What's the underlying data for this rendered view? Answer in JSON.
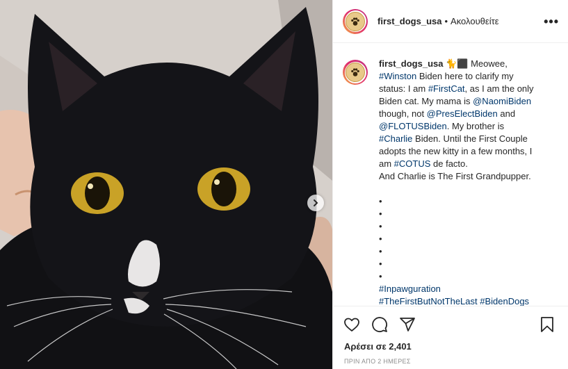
{
  "post": {
    "username": "first_dogs_usa",
    "dot": "•",
    "follow_status": "Ακολουθείτε",
    "more_label": "•••"
  },
  "caption": {
    "username": "first_dogs_usa",
    "emoji": "🐈⬛",
    "lines": [
      {
        "parts": [
          {
            "t": " Meowee,"
          }
        ]
      },
      {
        "parts": [
          {
            "t": "#Winston",
            "tag": true
          },
          {
            "t": " Biden here to clarify my"
          }
        ]
      },
      {
        "parts": [
          {
            "t": "status: I am "
          },
          {
            "t": "#FirstCat",
            "tag": true
          },
          {
            "t": ", as I am the only"
          }
        ]
      },
      {
        "parts": [
          {
            "t": "Biden cat. My mama is "
          },
          {
            "t": "@NaomiBiden",
            "tag": true
          }
        ]
      },
      {
        "parts": [
          {
            "t": "though, not "
          },
          {
            "t": "@PresElectBiden",
            "tag": true
          },
          {
            "t": " and"
          }
        ]
      },
      {
        "parts": [
          {
            "t": "@FLOTUSBiden",
            "tag": true
          },
          {
            "t": ". My brother is"
          }
        ]
      },
      {
        "parts": [
          {
            "t": "#Charlie",
            "tag": true
          },
          {
            "t": " Biden. Until the First Couple"
          }
        ]
      },
      {
        "parts": [
          {
            "t": "adopts the new kitty in a few months, I"
          }
        ]
      },
      {
        "parts": [
          {
            "t": "am "
          },
          {
            "t": "#COTUS",
            "tag": true
          },
          {
            "t": " de facto."
          }
        ]
      },
      {
        "parts": [
          {
            "t": "And Charlie is The First Grandpupper."
          }
        ]
      },
      {
        "parts": [
          {
            "t": " "
          }
        ]
      },
      {
        "parts": [
          {
            "t": "•"
          }
        ]
      },
      {
        "parts": [
          {
            "t": "•"
          }
        ]
      },
      {
        "parts": [
          {
            "t": "•"
          }
        ]
      },
      {
        "parts": [
          {
            "t": "•"
          }
        ]
      },
      {
        "parts": [
          {
            "t": "•"
          }
        ]
      },
      {
        "parts": [
          {
            "t": "•"
          }
        ]
      },
      {
        "parts": [
          {
            "t": "•"
          }
        ]
      },
      {
        "parts": [
          {
            "t": "#Inpawguration",
            "tag": true
          }
        ]
      },
      {
        "parts": [
          {
            "t": "#TheFirstButNotTheLast #BidenDogs",
            "tag": true
          }
        ]
      }
    ]
  },
  "stats": {
    "likes": "Αρέσει σε 2,401",
    "time": "ΠΡΙΝ ΑΠΟ 2 ΗΜΕΡΕΣ"
  },
  "icons": {
    "like": "heart-icon",
    "comment": "comment-icon",
    "share": "share-icon",
    "save": "bookmark-icon",
    "next": "chevron-right-icon",
    "avatar": "paw-icon"
  },
  "colors": {
    "link": "#00376b",
    "text": "#262626",
    "muted": "#8e8e8e",
    "cat_eye": "#c9a227"
  }
}
